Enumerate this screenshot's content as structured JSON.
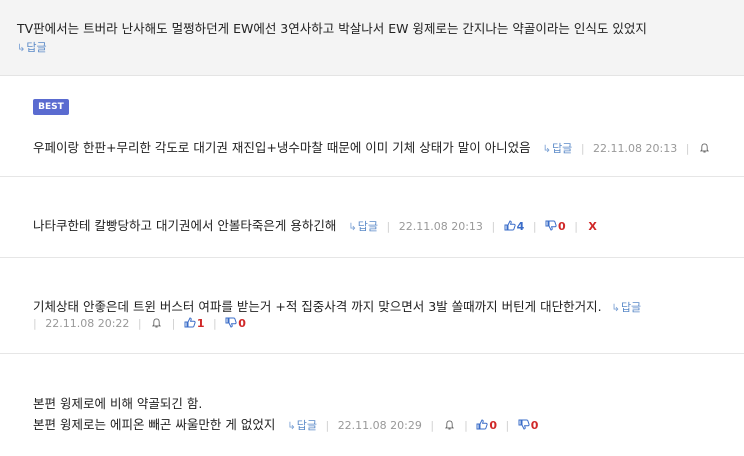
{
  "top_comment": {
    "text": "TV판에서는 트버라 난사해도 멀쩡하던게 EW에선 3연사하고 박살나서 EW 윙제로는 간지나는 약골이라는 인식도 있었지",
    "reply_label": "답글"
  },
  "best_badge": "BEST",
  "comments": [
    {
      "lines": [
        "우페이랑 한판+무리한 각도로 대기권 재진입+냉수마찰 때문에 이미 기체 상태가 말이 아니었음"
      ],
      "reply_label": "답글",
      "date": "22.11.08 20:13",
      "up": "",
      "down": ""
    },
    {
      "lines": [
        "나타쿠한테 칼빵당하고 대기권에서 안볼타죽은게 용하긴해"
      ],
      "reply_label": "답글",
      "date": "22.11.08 20:13",
      "up": "4",
      "down": "0",
      "delete_label": "X"
    },
    {
      "lines": [
        "기체상태 안좋은데 트윈 버스터 여파를 받는거 +적 집중사격 까지 맞으면서 3발 쏠때까지 버틴게 대단한거지."
      ],
      "reply_label": "답글",
      "date": "22.11.08 20:22",
      "up": "1",
      "down": "0"
    },
    {
      "lines": [
        "본편 윙제로에 비해 약골되긴 함.",
        "본편 윙제로는 에피온 빼곤 싸울만한 게 없었지"
      ],
      "reply_label": "답글",
      "date": "22.11.08 20:29",
      "up": "0",
      "down": "0"
    }
  ],
  "colors": {
    "best_badge": "#5a6bd0",
    "reply_link": "#5b8ac8",
    "upvote": "#3a6cc8",
    "downvote": "#d02828",
    "top_background": "#f4f4f4"
  },
  "icons": [
    "reply-arrow-icon",
    "alarm-icon",
    "thumbs-up-icon",
    "thumbs-down-icon",
    "delete-icon"
  ]
}
